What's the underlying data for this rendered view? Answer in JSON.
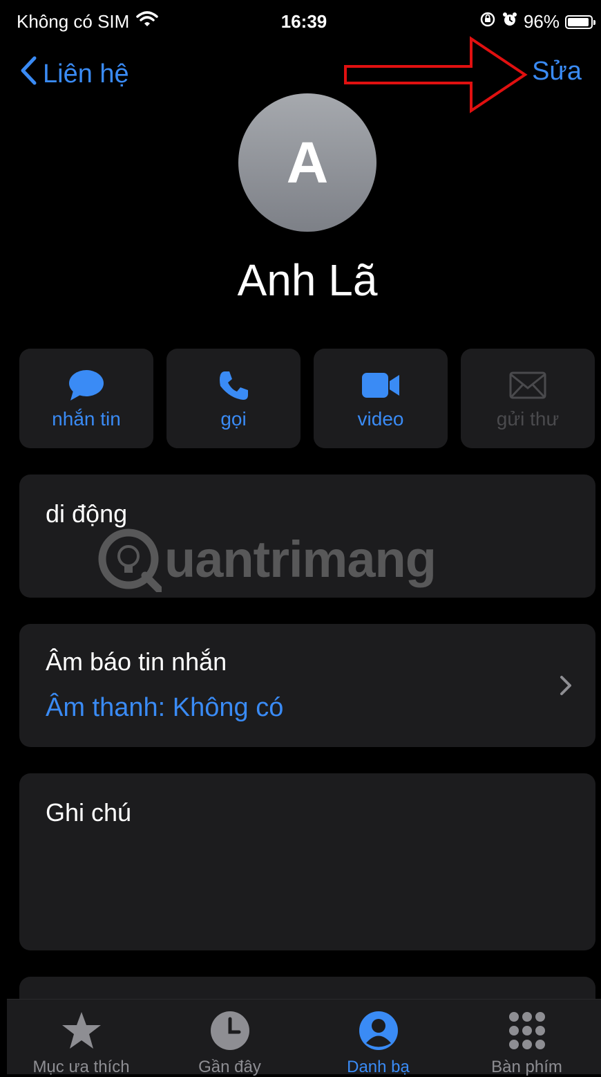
{
  "status_bar": {
    "carrier": "Không có SIM",
    "time": "16:39",
    "battery": "96%"
  },
  "nav": {
    "back_label": "Liên hệ",
    "edit_label": "Sửa"
  },
  "contact": {
    "initial": "A",
    "name": "Anh Lã"
  },
  "actions": [
    {
      "label": "nhắn tin",
      "icon": "message-bubble-icon",
      "enabled": true
    },
    {
      "label": "gọi",
      "icon": "phone-icon",
      "enabled": true
    },
    {
      "label": "video",
      "icon": "video-camera-icon",
      "enabled": true
    },
    {
      "label": "gửi thư",
      "icon": "mail-envelope-icon",
      "enabled": false
    }
  ],
  "phone_card": {
    "label": "di động"
  },
  "text_tone_card": {
    "title": "Âm báo tin nhắn",
    "value": "Âm thanh: Không có"
  },
  "notes_card": {
    "label": "Ghi chú"
  },
  "watermark": {
    "text": "uantrimang"
  },
  "tabbar": [
    {
      "label": "Mục ưa thích",
      "icon": "star-icon",
      "active": false
    },
    {
      "label": "Gần đây",
      "icon": "clock-icon",
      "active": false
    },
    {
      "label": "Danh bạ",
      "icon": "person-circle-icon",
      "active": true
    },
    {
      "label": "Bàn phím",
      "icon": "keypad-icon",
      "active": false
    }
  ],
  "colors": {
    "accent": "#3a8bf5",
    "card": "#1c1c1e",
    "annotation": "#e01010"
  }
}
